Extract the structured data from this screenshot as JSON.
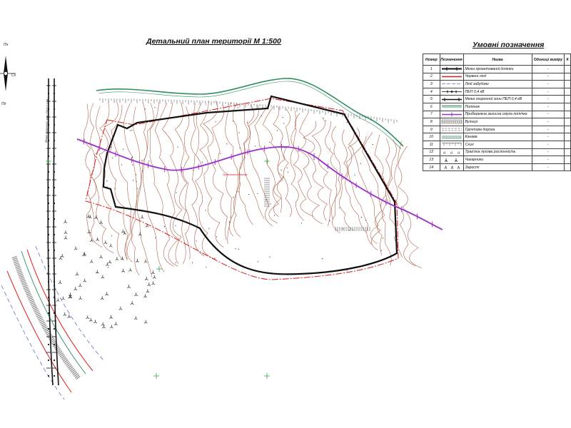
{
  "title": "Детальний план території М 1:500",
  "compass": {
    "north": "Пн",
    "south": "Пд",
    "east": "Сх"
  },
  "plan_labels": {
    "road": "вул. ...",
    "power_line_note": "Межа охоронної зони ПЕП 0,4 кВ"
  },
  "legend": {
    "title": "Умовні позначення",
    "headers": {
      "number": "Номер",
      "symbol": "Позначення",
      "name": "Назва",
      "unit": "Одиниці виміру",
      "qty": "К"
    },
    "rows": [
      {
        "number": "1",
        "symbol": "design-boundary-line",
        "name": "Межа проектованої ділянки",
        "unit": "-"
      },
      {
        "number": "2",
        "symbol": "red-line",
        "name": "Червоні лінії",
        "unit": "-"
      },
      {
        "number": "3",
        "symbol": "building-line",
        "name": "Лінії забудови",
        "unit": "-"
      },
      {
        "number": "4",
        "symbol": "power-line",
        "name": "ПЕП 0,4 кВ",
        "unit": "-"
      },
      {
        "number": "5",
        "symbol": "protection-zone-line",
        "name": "Межа охоронної зони ПЕП 0,4 кВ",
        "unit": "-"
      },
      {
        "number": "6",
        "symbol": "lawn-strip",
        "name": "Полянок",
        "unit": "-"
      },
      {
        "number": "7",
        "symbol": "stream-protection-strip",
        "name": "Прибережна захисна смуга потічка",
        "unit": "-"
      },
      {
        "number": "8",
        "symbol": "street-hatch",
        "name": "Вулиця",
        "unit": "-"
      },
      {
        "number": "9",
        "symbol": "dirt-road",
        "name": "Ґрунтова дорога",
        "unit": "-"
      },
      {
        "number": "10",
        "symbol": "ditch",
        "name": "Канава",
        "unit": "-"
      },
      {
        "number": "11",
        "symbol": "slope",
        "name": "Схил",
        "unit": "-"
      },
      {
        "number": "12",
        "symbol": "meadow-grass",
        "name": "Трав'яна лугова рослинність",
        "unit": "-"
      },
      {
        "number": "13",
        "symbol": "shrubs",
        "name": "Чагарники",
        "unit": "-"
      },
      {
        "number": "14",
        "symbol": "thickets",
        "name": "Зарості",
        "unit": "-"
      }
    ]
  },
  "colors": {
    "contour": "#a8553b",
    "boundary": "#111111",
    "red_line": "#d81b1b",
    "building_line": "#5577cc",
    "stream": "#9b30c9",
    "lawn": "#2f8f5e",
    "grid_cross": "#2fa84a",
    "street": "#8a8a8a"
  }
}
